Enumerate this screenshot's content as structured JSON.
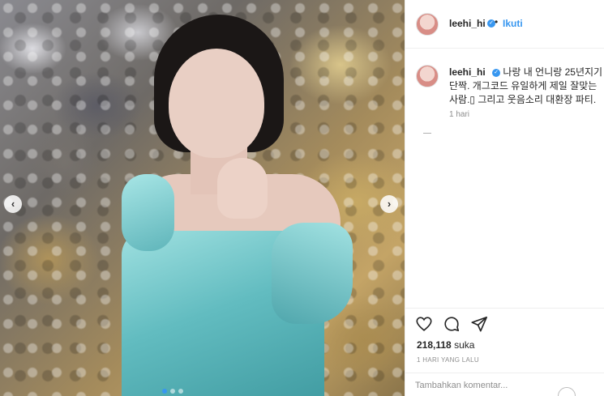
{
  "post": {
    "username": "leehi_hi",
    "follow_label": "Ikuti",
    "separator": "•",
    "verified_mark": "✓",
    "caption_username": "leehi_hi",
    "caption_lines": [
      "나랑 내 언니랑 25년지기",
      "단짝. 개그코드 유일하게 제일 잘맞는",
      "사람.▯ 그리고 웃음소리 대환장 파티."
    ],
    "caption_time": "1 hari",
    "likes_count": "218,118",
    "likes_suffix": "suka",
    "post_time": "1 HARI YANG LALU",
    "comment_placeholder": "Tambahkan komentar...",
    "photo_nav": {
      "prev_glyph": "‹",
      "next_glyph": "›"
    },
    "icons": {
      "like": "heart-icon",
      "comment": "comment-icon",
      "share": "share-icon"
    },
    "colors": {
      "accent": "#3897f0",
      "text": "#262626",
      "muted": "#8e8e8e",
      "dress": "#62bcc0"
    }
  }
}
